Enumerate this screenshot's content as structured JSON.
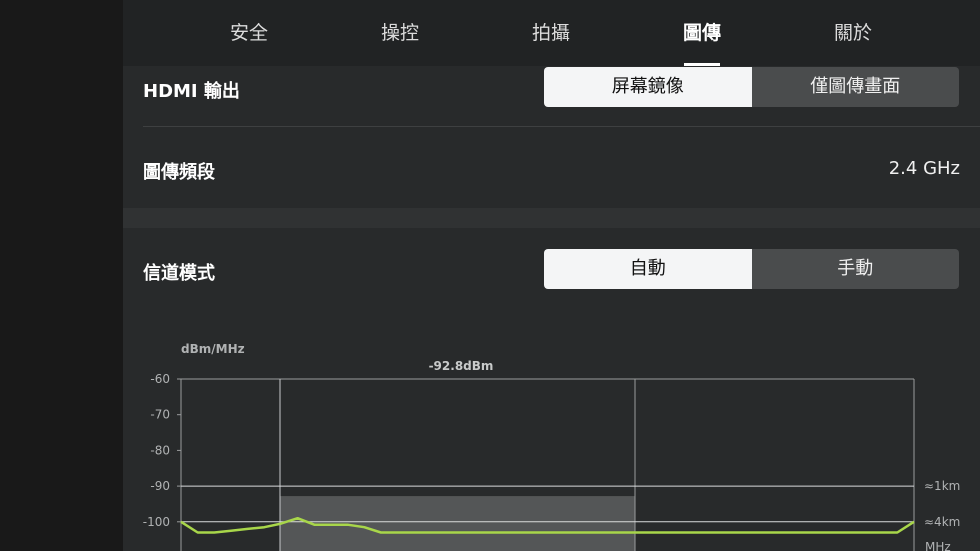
{
  "tabs": [
    {
      "label": "安全",
      "active": false
    },
    {
      "label": "操控",
      "active": false
    },
    {
      "label": "拍攝",
      "active": false
    },
    {
      "label": "圖傳",
      "active": true
    },
    {
      "label": "關於",
      "active": false
    }
  ],
  "hdmi": {
    "label": "HDMI 輸出",
    "options": [
      "屏幕鏡像",
      "僅圖傳畫面"
    ],
    "selected": 0
  },
  "band": {
    "label": "圖傳頻段",
    "value": "2.4 GHz"
  },
  "channel": {
    "label": "信道模式",
    "options": [
      "自動",
      "手動"
    ],
    "selected": 0
  },
  "chart_data": {
    "type": "line",
    "ylabel": "dBm/MHz",
    "y_ticks": [
      "-60",
      "-70",
      "-80",
      "-90",
      "-100"
    ],
    "ylim": [
      -103,
      -60
    ],
    "highlight_label": "-92.8dBm",
    "highlight_value": -92.8,
    "ref_lines": [
      {
        "label": "≈1km",
        "value": -90
      },
      {
        "label": "≈4km",
        "value": -100
      }
    ],
    "xlabel": "MHz",
    "series": [
      {
        "color": "#a8d64a",
        "values": [
          -100,
          -103,
          -103,
          -102.5,
          -102,
          -101.5,
          -100.5,
          -99,
          -100.8,
          -100.8,
          -100.8,
          -101.5,
          -103,
          -103,
          -103,
          -103,
          -103,
          -103,
          -103,
          -103,
          -103,
          -103,
          -103,
          -103,
          -103,
          -103,
          -103,
          -103,
          -103,
          -103,
          -103,
          -103,
          -103,
          -103,
          -103,
          -103,
          -103,
          -103,
          -103,
          -103,
          -103,
          -103,
          -103,
          -103,
          -100
        ]
      }
    ]
  }
}
